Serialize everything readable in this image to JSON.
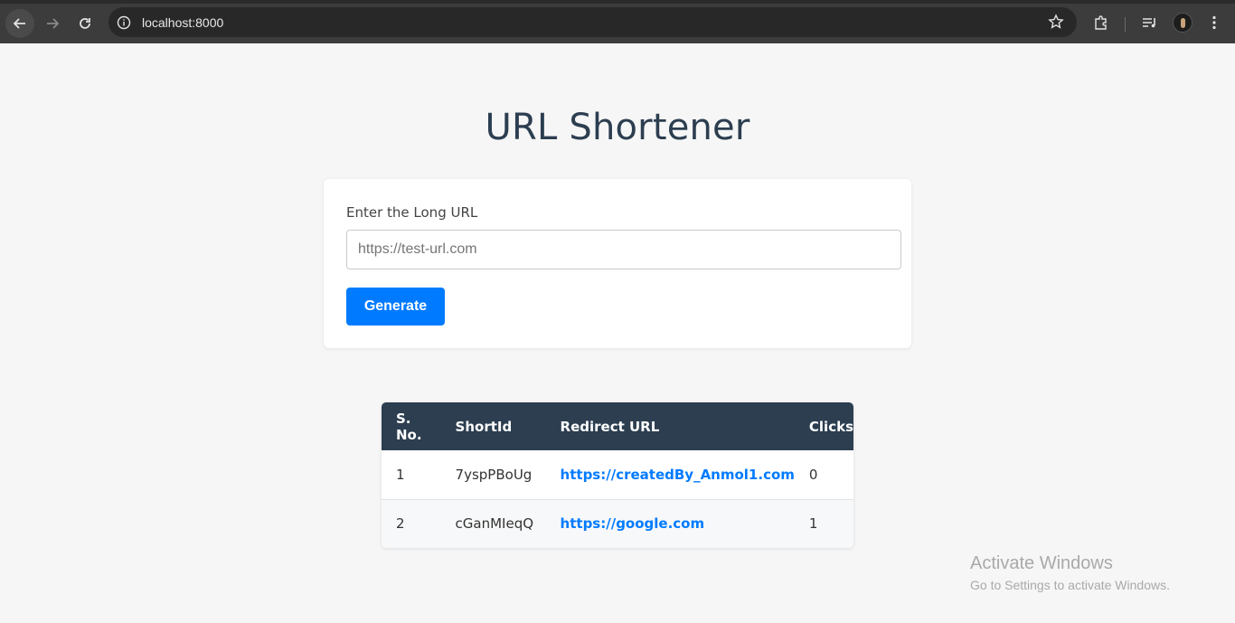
{
  "browser": {
    "url": "localhost:8000",
    "icons": [
      "back-arrow-icon",
      "forward-arrow-icon",
      "reload-icon",
      "site-info-icon",
      "bookmark-star-icon",
      "extensions-icon",
      "media-controls-icon",
      "profile-avatar",
      "more-menu-icon"
    ]
  },
  "page": {
    "title": "URL Shortener",
    "form": {
      "label": "Enter the Long URL",
      "placeholder": "https://test-url.com",
      "button_label": "Generate"
    },
    "table": {
      "headers": [
        "S. No.",
        "ShortId",
        "Redirect URL",
        "Clicks"
      ],
      "rows": [
        {
          "sno": "1",
          "short_id": "7yspPBoUg",
          "redirect_url": "https://createdBy_Anmol1.com",
          "clicks": "0"
        },
        {
          "sno": "2",
          "short_id": "cGanMIeqQ",
          "redirect_url": "https://google.com",
          "clicks": "1"
        }
      ]
    }
  },
  "watermark": {
    "line1": "Activate Windows",
    "line2": "Go to Settings to activate Windows."
  },
  "colors": {
    "accent": "#007bff",
    "header_bg": "#2c3e50",
    "page_bg": "#f6f6f6"
  }
}
